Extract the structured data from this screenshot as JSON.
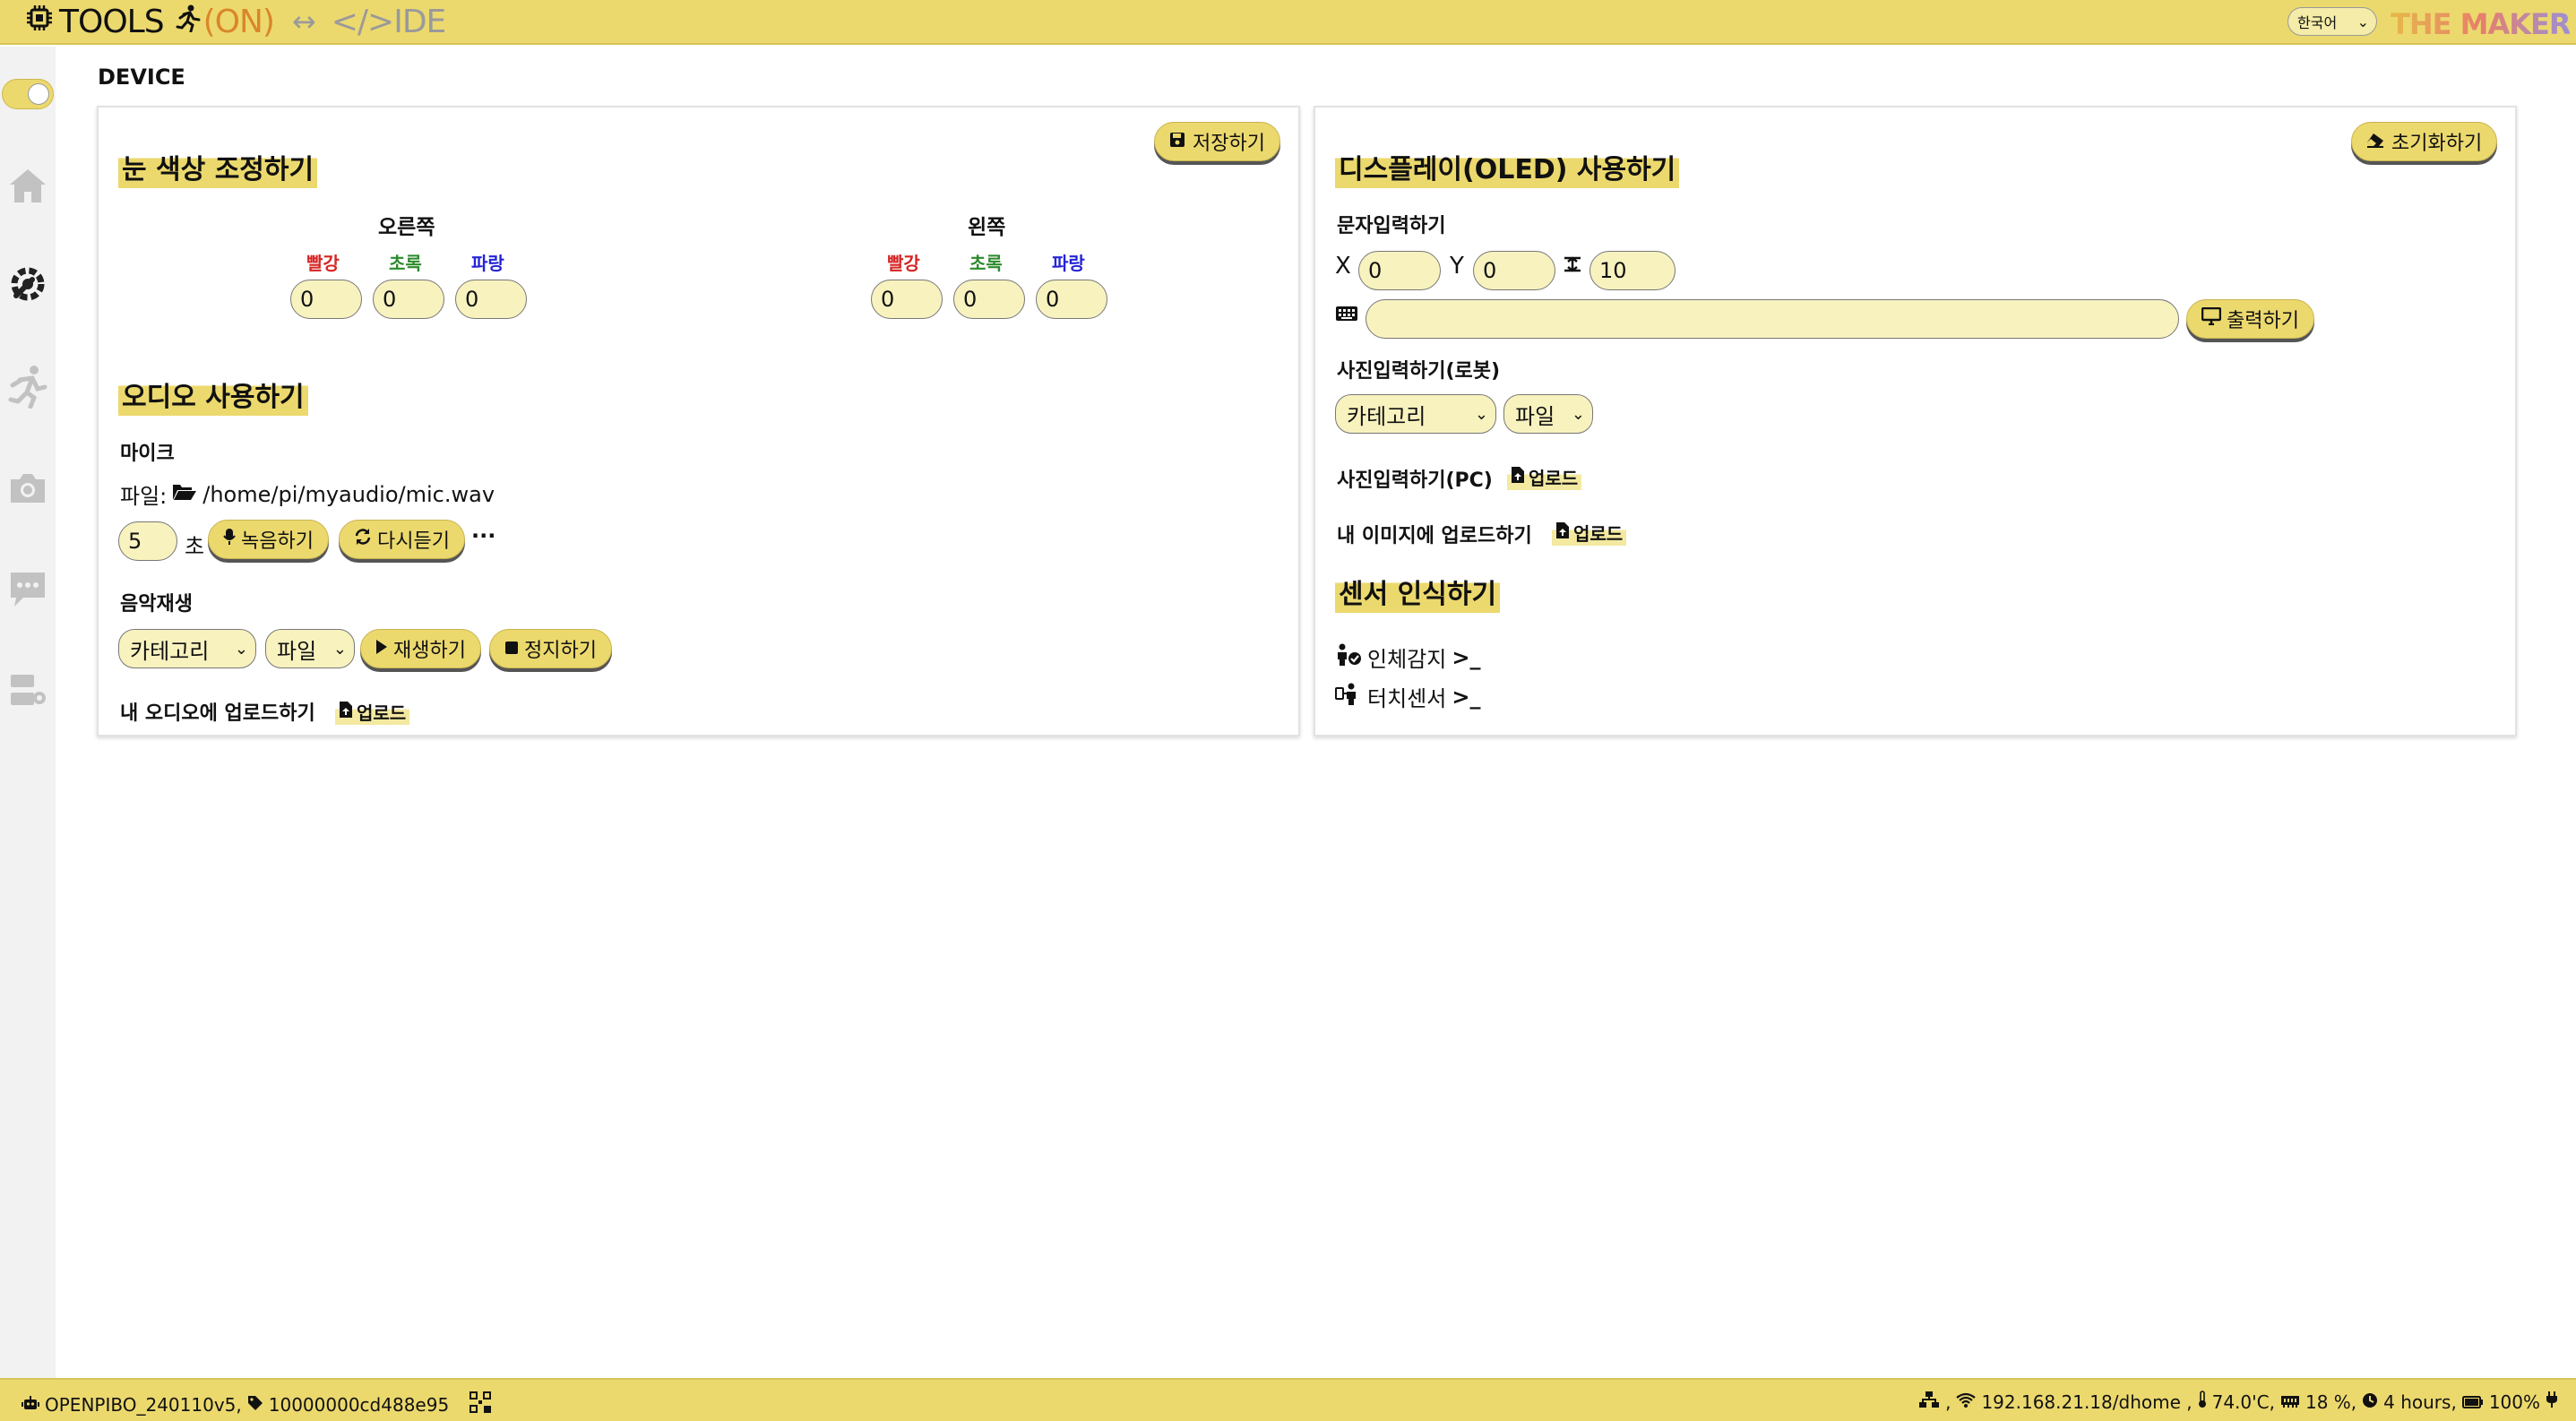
{
  "header": {
    "tools_label": "TOOLS",
    "on_label": "(ON)",
    "arrow": "↔",
    "ide_label": "</>IDE",
    "language": "한국어",
    "maker_logo": "THE MAKER"
  },
  "page": {
    "title": "DEVICE"
  },
  "eye": {
    "save_label": "저장하기",
    "title": "눈 색상 조정하기",
    "right_title": "오른쪽",
    "left_title": "왼쪽",
    "red_label": "빨강",
    "green_label": "초록",
    "blue_label": "파랑",
    "right_values": [
      "0",
      "0",
      "0"
    ],
    "left_values": [
      "0",
      "0",
      "0"
    ]
  },
  "audio": {
    "title": "오디오 사용하기",
    "mic_label": "마이크",
    "file_label": "파일:",
    "file_path": "/home/pi/myaudio/mic.wav",
    "duration": "5",
    "sec_label": "초",
    "record_label": "녹음하기",
    "replay_label": "다시듣기",
    "more": "···",
    "music_label": "음악재생",
    "category": "카테고리",
    "file_select": "파일",
    "play_label": "재생하기",
    "stop_label": "정지하기",
    "upload_title": "내 오디오에 업로드하기",
    "upload_label": "업로드"
  },
  "display": {
    "reset_label": "초기화하기",
    "title": "디스플레이(OLED) 사용하기",
    "text_input_label": "문자입력하기",
    "x_label": "X",
    "x_value": "0",
    "y_label": "Y",
    "y_value": "0",
    "size_value": "10",
    "text_value": "",
    "print_label": "출력하기",
    "photo_robot_label": "사진입력하기(로봇)",
    "category": "카테고리",
    "file_select": "파일",
    "photo_pc_label": "사진입력하기(PC)",
    "upload_label": "업로드",
    "my_image_label": "내 이미지에 업로드하기"
  },
  "sensor": {
    "title": "센서 인식하기",
    "human_label": "인체감지",
    "touch_label": "터치센서",
    "prompt": ">_"
  },
  "footer": {
    "device": "OPENPIBO_240110v5,",
    "serial": "10000000cd488e95",
    "network": ",",
    "ip": "192.168.21.18/dhome ,",
    "temp": "74.0'C,",
    "memory": "18 %,",
    "uptime": "4 hours,",
    "battery": "100%"
  },
  "colors": {
    "accent": "#ecd96e",
    "input_bg": "#f8f2bf"
  }
}
